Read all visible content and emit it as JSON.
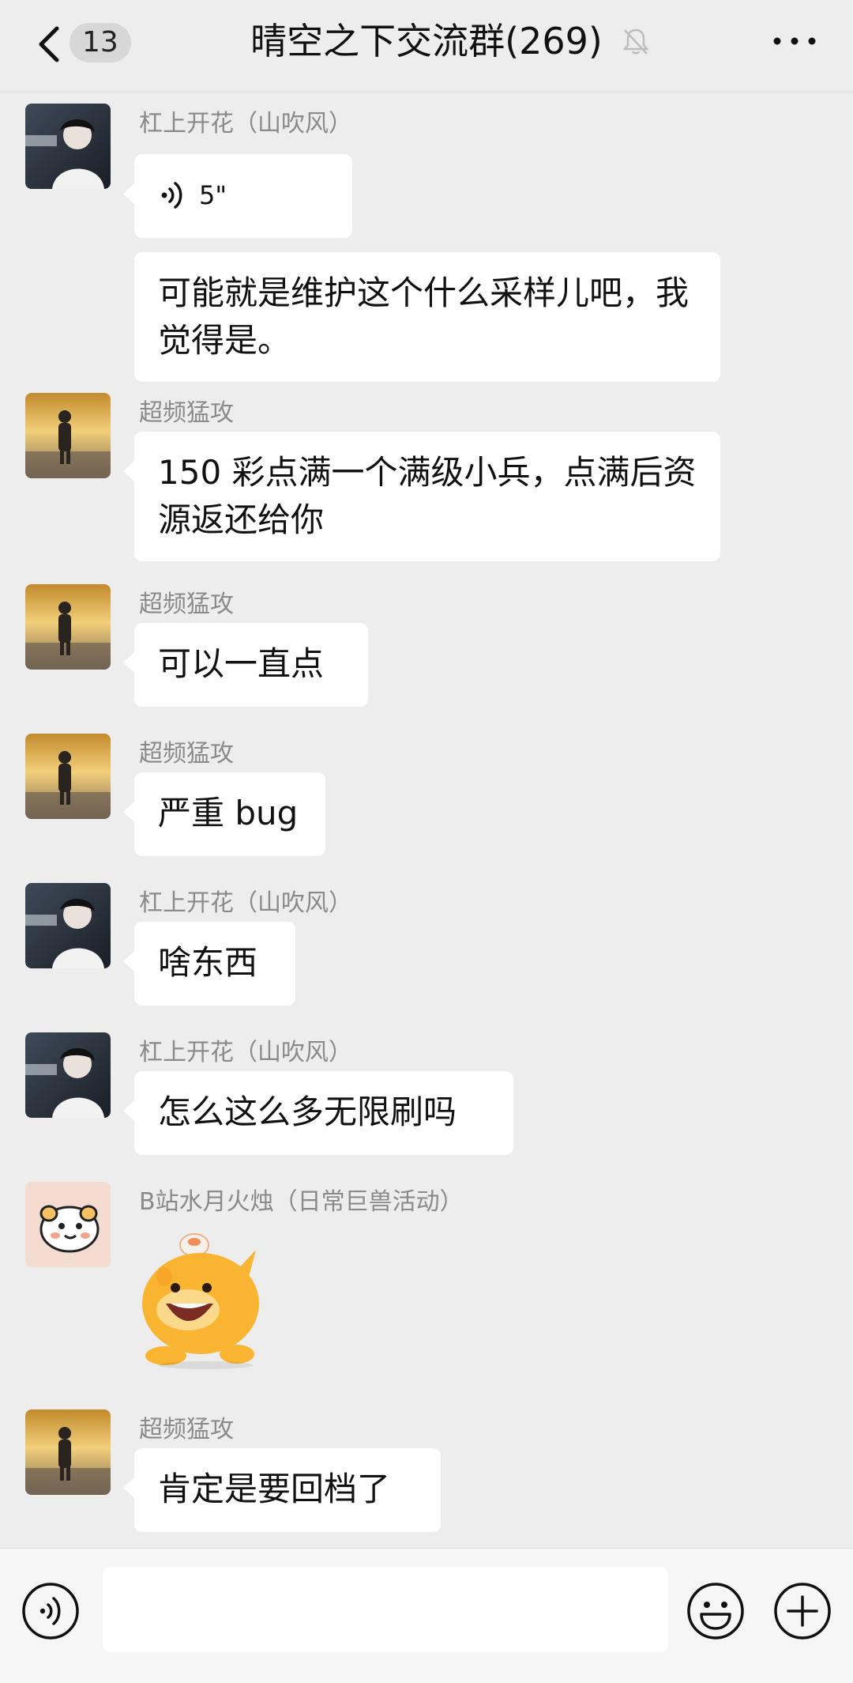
{
  "header": {
    "unread_count": "13",
    "title": "晴空之下交流群(269)"
  },
  "messages": [
    {
      "sender": "杠上开花（山吹风）",
      "avatar": "user-a",
      "voice_duration": "5\"",
      "text": "可能就是维护这个什么采样儿吧，我觉得是。"
    },
    {
      "sender": "超频猛攻",
      "avatar": "user-b",
      "text": "150 彩点满一个满级小兵，点满后资源返还给你"
    },
    {
      "sender": "超频猛攻",
      "avatar": "user-b",
      "text": "可以一直点"
    },
    {
      "sender": "超频猛攻",
      "avatar": "user-b",
      "text": "严重 bug"
    },
    {
      "sender": "杠上开花（山吹风）",
      "avatar": "user-a",
      "text": "啥东西"
    },
    {
      "sender": "杠上开花（山吹风）",
      "avatar": "user-a",
      "text": "怎么这么多无限刷吗"
    },
    {
      "sender": "B站水月火烛（日常巨兽活动）",
      "avatar": "user-c",
      "sticker": "yellow-creature-sticker"
    },
    {
      "sender": "超频猛攻",
      "avatar": "user-b",
      "text": "肯定是要回档了"
    }
  ],
  "input": {
    "placeholder": ""
  },
  "colors": {
    "background": "#ededed",
    "bubble": "#ffffff",
    "sender_name": "#8a8a8a"
  }
}
